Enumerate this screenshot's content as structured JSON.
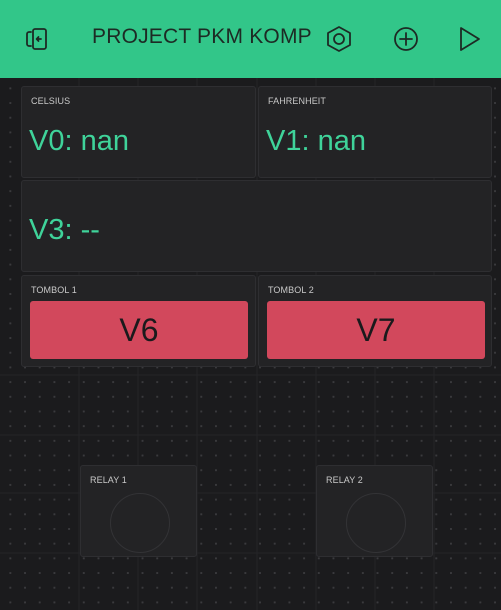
{
  "header": {
    "title": "PROJECT PKM KOMP",
    "icons": [
      "device-icon",
      "settings-hex-icon",
      "add-icon",
      "play-icon"
    ]
  },
  "widgets": {
    "celsius": {
      "label": "CELSIUS",
      "value": "V0: nan"
    },
    "fahrenheit": {
      "label": "FAHRENHEIT",
      "value": "V1: nan"
    },
    "v3": {
      "value": "V3: --"
    },
    "tombol1": {
      "label": "TOMBOL 1",
      "button": "V6"
    },
    "tombol2": {
      "label": "TOMBOL 2",
      "button": "V7"
    },
    "relay1": {
      "label": "RELAY 1"
    },
    "relay2": {
      "label": "RELAY 2"
    }
  },
  "colors": {
    "header_bg": "#32c689",
    "accent_green": "#3fd39a",
    "button_red": "#d2485c",
    "widget_bg": "#232325",
    "canvas_bg": "#1b1b1d"
  }
}
